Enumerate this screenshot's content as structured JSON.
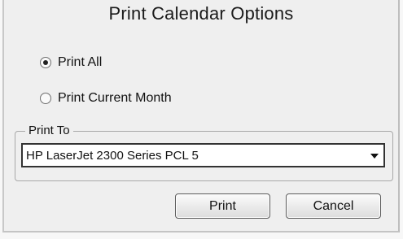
{
  "dialog": {
    "title": "Print Calendar Options"
  },
  "options": {
    "print_all": {
      "label": "Print All",
      "selected": true
    },
    "print_current_month": {
      "label": "Print Current Month",
      "selected": false
    }
  },
  "print_to": {
    "label": "Print To",
    "selected_printer": "HP LaserJet 2300 Series PCL 5"
  },
  "buttons": {
    "print_label": "Print",
    "cancel_label": "Cancel"
  }
}
